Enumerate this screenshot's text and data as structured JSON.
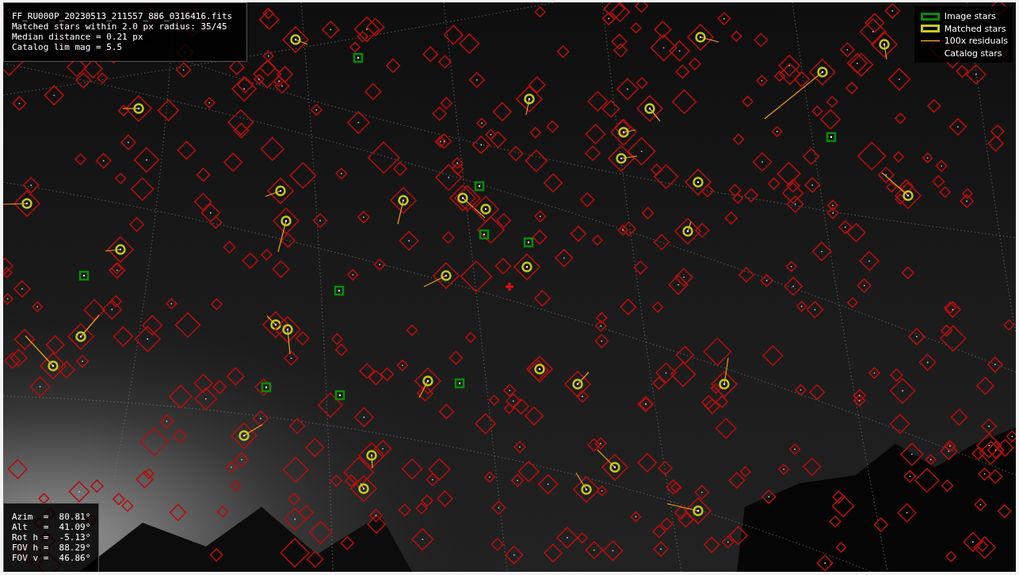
{
  "header": {
    "lines": [
      "FF_RU000P_20230513_211557_886_0316416.fits",
      "Matched stars within 2.0 px radius: 35/45",
      "Median distance = 0.21 px",
      "Catalog lim mag = 5.5"
    ]
  },
  "legend": {
    "items": [
      {
        "kind": "image",
        "label": "Image stars"
      },
      {
        "kind": "matched",
        "label": "Matched stars"
      },
      {
        "kind": "residual",
        "label": "100x residuals"
      },
      {
        "kind": "catalog",
        "label": "Catalog stars"
      }
    ]
  },
  "pointing": {
    "lines": [
      "Azim  =  80.81°",
      "Alt   =  41.09°",
      "Rot h =  -5.13°",
      "FOV h =  88.29°",
      "FOV v =  46.86°"
    ]
  }
}
